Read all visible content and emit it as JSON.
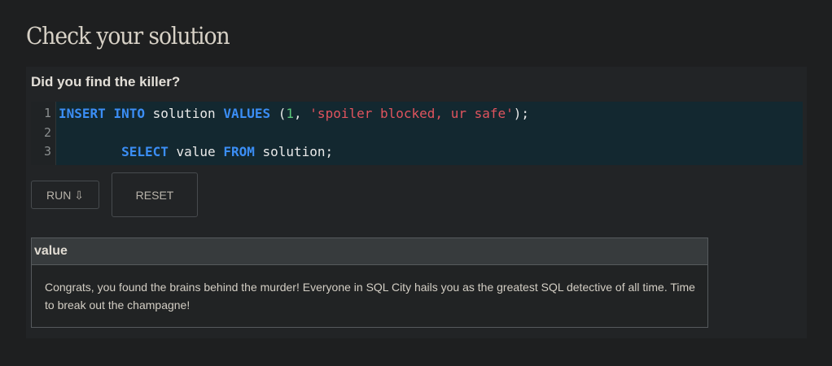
{
  "page": {
    "title": "Check your solution"
  },
  "panel": {
    "heading": "Did you find the killer?"
  },
  "editor": {
    "line_numbers": [
      "1",
      "2",
      "3"
    ],
    "lines": [
      {
        "kw1": "INSERT",
        "kw2": "INTO",
        "table": "solution",
        "kw3": "VALUES",
        "open": "(",
        "num": "1",
        "sep": ", ",
        "str": "'spoiler blocked, ur safe'",
        "close": ");"
      },
      {},
      {
        "kw1": "SELECT",
        "col": "value",
        "kw2": "FROM",
        "table": "solution;"
      }
    ],
    "colors": {
      "keyword": "#3b8ef5",
      "number": "#5bc77a",
      "string": "#e0545e",
      "background": "#132830"
    }
  },
  "buttons": {
    "run_label": "RUN ⇩",
    "reset_label": "RESET"
  },
  "results": {
    "columns": [
      "value"
    ],
    "rows": [
      [
        "Congrats, you found the brains behind the murder! Everyone in SQL City hails you as the greatest SQL detective of all time. Time to break out the champagne!"
      ]
    ]
  }
}
